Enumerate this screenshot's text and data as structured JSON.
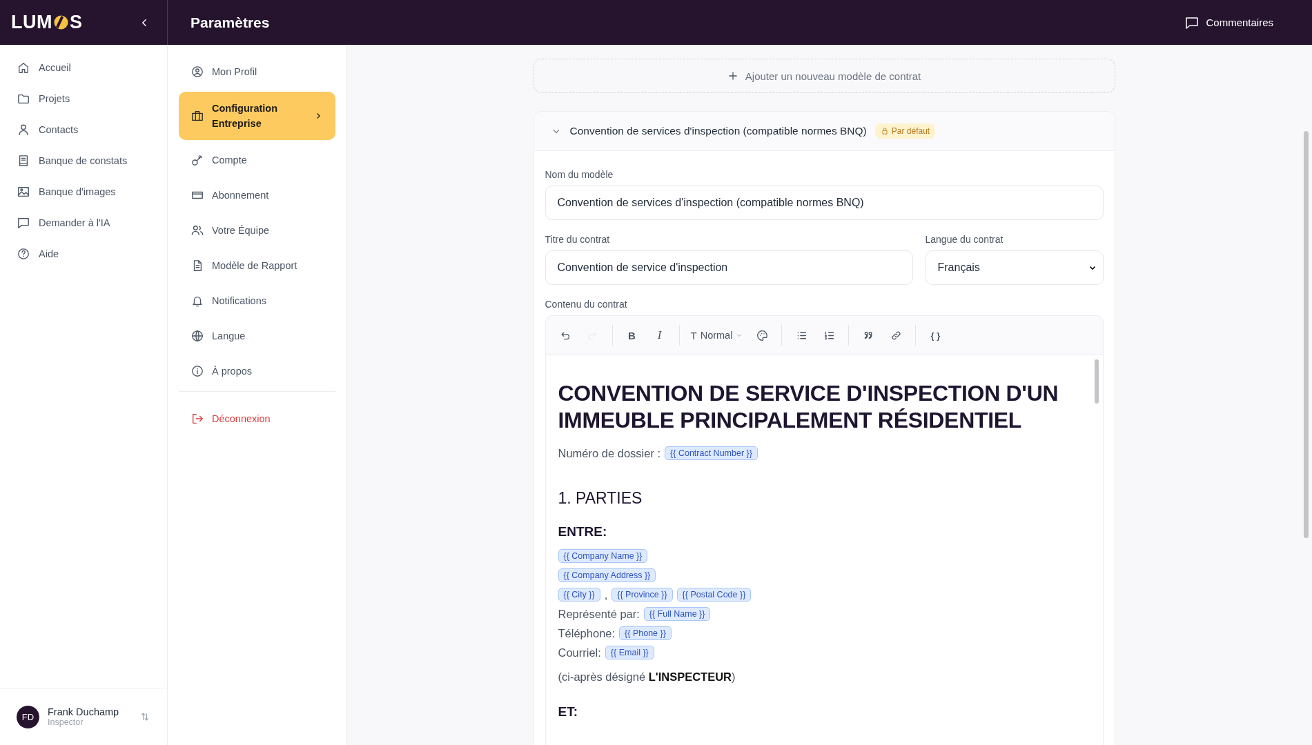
{
  "sidebar": {
    "logo": {
      "before": "LUM",
      "after": "S"
    },
    "nav": [
      {
        "label": "Accueil"
      },
      {
        "label": "Projets"
      },
      {
        "label": "Contacts"
      },
      {
        "label": "Banque de constats"
      },
      {
        "label": "Banque d'images"
      },
      {
        "label": "Demander à l'IA"
      },
      {
        "label": "Aide"
      }
    ],
    "user": {
      "initials": "FD",
      "name": "Frank Duchamp",
      "role": "Inspector"
    }
  },
  "header": {
    "title": "Paramètres",
    "comments": "Commentaires"
  },
  "settings": {
    "items": [
      {
        "label": "Mon Profil",
        "selected": false
      },
      {
        "label": "Configuration Entreprise",
        "selected": true
      },
      {
        "label": "Compte",
        "selected": false
      },
      {
        "label": "Abonnement",
        "selected": false
      },
      {
        "label": "Votre Équipe",
        "selected": false
      },
      {
        "label": "Modèle de Rapport",
        "selected": false
      },
      {
        "label": "Notifications",
        "selected": false
      },
      {
        "label": "Langue",
        "selected": false
      },
      {
        "label": "À propos",
        "selected": false
      }
    ],
    "logout": "Déconnexion"
  },
  "contracts": {
    "add_label": "Ajouter un nouveau modèle de contrat",
    "template": {
      "expanded": true,
      "title": "Convention de services d'inspection (compatible normes BNQ)",
      "badge": "Par défaut",
      "name_label": "Nom du modèle",
      "name_value": "Convention de services d'inspection (compatible normes BNQ)",
      "title_label": "Titre du contrat",
      "title_value": "Convention de service d'inspection",
      "language_label": "Langue du contrat",
      "language_value": "Français",
      "content_label": "Contenu du contrat",
      "toolbar": [
        [
          {
            "kind": "undo",
            "disabled": false
          },
          {
            "kind": "redo",
            "disabled": true
          }
        ],
        [
          {
            "kind": "bold",
            "glyph": "B",
            "disabled": false
          },
          {
            "kind": "italic",
            "glyph": "I",
            "disabled": false
          }
        ],
        [
          {
            "kind": "style",
            "glyph": "T",
            "label": "Normal",
            "disabled": false
          },
          {
            "kind": "color",
            "disabled": false
          }
        ],
        [
          {
            "kind": "bullets",
            "disabled": false
          },
          {
            "kind": "numbered",
            "disabled": false
          }
        ],
        [
          {
            "kind": "quote",
            "disabled": false
          },
          {
            "kind": "link",
            "disabled": false
          }
        ],
        [
          {
            "kind": "variable",
            "glyph": "{ }",
            "disabled": false
          }
        ]
      ],
      "document": [
        {
          "kind": "title",
          "text": "CONVENTION DE SERVICE D'INSPECTION D'UN IMMEUBLE PRINCIPALEMENT RÉSIDENTIEL"
        },
        {
          "kind": "line",
          "parts": [
            {
              "kind": "text",
              "text": "Numéro de dossier :"
            },
            {
              "kind": "chip",
              "text": "{{ Contract Number }}"
            }
          ]
        },
        {
          "kind": "section",
          "text": "1. PARTIES"
        },
        {
          "kind": "subsection",
          "text": "ENTRE:"
        },
        {
          "kind": "line",
          "parts": [
            {
              "kind": "chip",
              "text": "{{ Company Name }}"
            }
          ]
        },
        {
          "kind": "line",
          "parts": [
            {
              "kind": "chip",
              "text": "{{ Company Address }}"
            }
          ]
        },
        {
          "kind": "line",
          "parts": [
            {
              "kind": "chip",
              "text": "{{ City }}"
            },
            {
              "kind": "text",
              "text": ","
            },
            {
              "kind": "chip",
              "text": "{{ Province }}"
            },
            {
              "kind": "chip",
              "text": "{{ Postal Code }}"
            }
          ]
        },
        {
          "kind": "line",
          "parts": [
            {
              "kind": "text",
              "text": "Représenté par:"
            },
            {
              "kind": "chip",
              "text": "{{ Full Name }}"
            }
          ]
        },
        {
          "kind": "line",
          "parts": [
            {
              "kind": "text",
              "text": "Téléphone:"
            },
            {
              "kind": "chip",
              "text": "{{ Phone }}"
            }
          ]
        },
        {
          "kind": "line",
          "parts": [
            {
              "kind": "text",
              "text": "Courriel:"
            },
            {
              "kind": "chip",
              "text": "{{ Email }}"
            }
          ]
        },
        {
          "kind": "paragraph",
          "text": "(ci-après désigné **L'INSPECTEUR**)"
        },
        {
          "kind": "subsection",
          "text": "ET:"
        }
      ]
    }
  }
}
